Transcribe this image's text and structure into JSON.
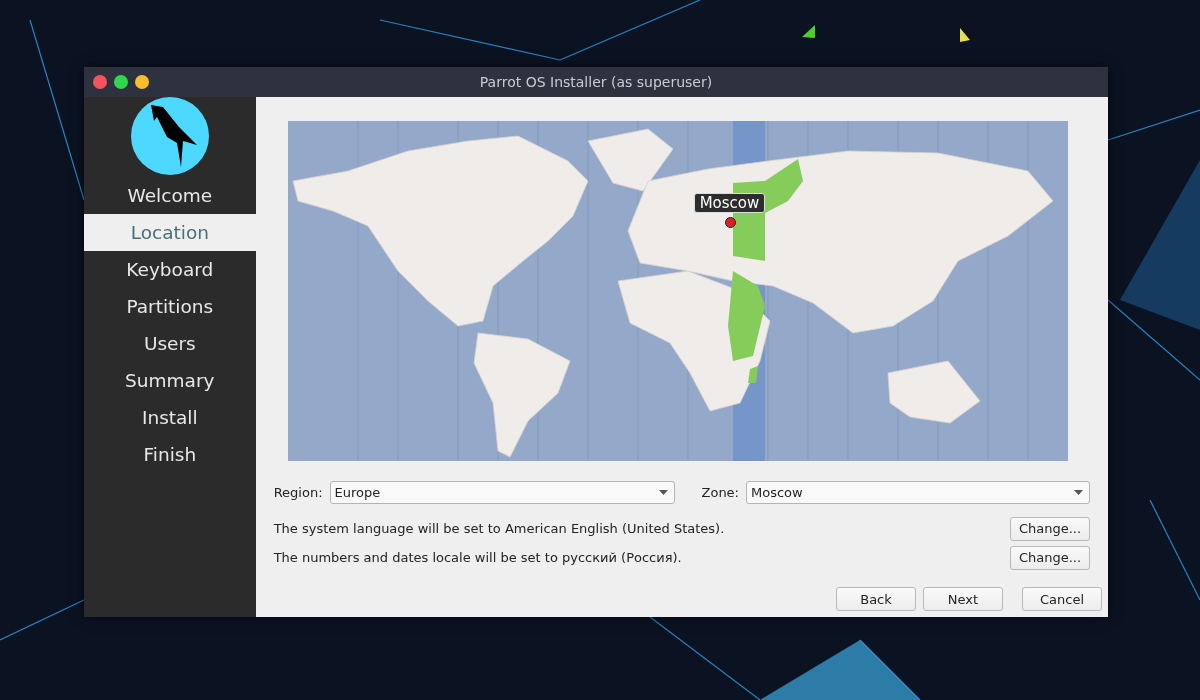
{
  "window": {
    "title": "Parrot OS Installer (as superuser)"
  },
  "sidebar": {
    "items": [
      {
        "label": "Welcome",
        "selected": false
      },
      {
        "label": "Location",
        "selected": true
      },
      {
        "label": "Keyboard",
        "selected": false
      },
      {
        "label": "Partitions",
        "selected": false
      },
      {
        "label": "Users",
        "selected": false
      },
      {
        "label": "Summary",
        "selected": false
      },
      {
        "label": "Install",
        "selected": false
      },
      {
        "label": "Finish",
        "selected": false
      }
    ]
  },
  "map": {
    "marker": {
      "label": "Moscow"
    }
  },
  "region": {
    "label": "Region:",
    "value": "Europe"
  },
  "zone": {
    "label": "Zone:",
    "value": "Moscow"
  },
  "locale_rows": [
    {
      "text": "The system language will be set to American English (United States).",
      "button": "Change..."
    },
    {
      "text": "The numbers and dates locale will be set to русский (Россия).",
      "button": "Change..."
    }
  ],
  "buttons": [
    "Back",
    "Next",
    "Cancel"
  ]
}
